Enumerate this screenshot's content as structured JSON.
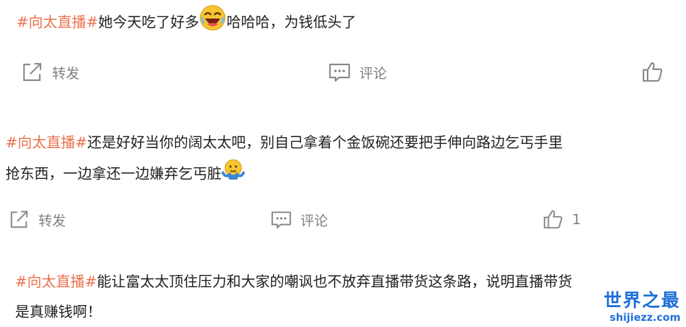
{
  "posts": [
    {
      "hashtag": "#向太直播#",
      "lines": [
        "她今天吃了好多",
        "哈哈哈，为钱低头了"
      ],
      "emoji": "laughing-face",
      "actions": {
        "repost": "转发",
        "comment": "评论",
        "like_count": ""
      }
    },
    {
      "hashtag": "#向太直播#",
      "lines": [
        "还是好好当你的阔太太吧，别自己拿着个金饭碗还要把手伸向路边乞丐手里",
        "抢东西，一边拿还一边嫌弃乞丐脏"
      ],
      "emoji": "shrug-face",
      "actions": {
        "repost": "转发",
        "comment": "评论",
        "like_count": "1"
      }
    },
    {
      "hashtag": "#向太直播#",
      "lines": [
        "能让富太太顶住压力和大家的嘲讽也不放弃直播带货这条路，说明直播带货",
        "是真赚钱啊！"
      ]
    }
  ],
  "watermark": {
    "title": "世界之最",
    "url": "shijiezz.com"
  },
  "colors": {
    "hashtag": "#eb7350",
    "text": "#222222",
    "action": "#808080",
    "watermark": "#1e6fd9"
  }
}
